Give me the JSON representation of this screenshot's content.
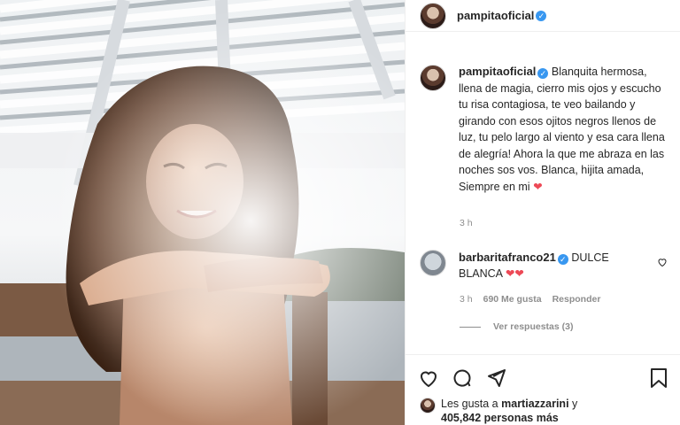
{
  "post": {
    "username": "pampitaoficial",
    "caption": "Blanquita hermosa, llena de magia, cierro mis ojos y escucho tu risa contagiosa, te veo bailando y girando con esos ojitos negros llenos de luz, tu pelo largo al viento y esa cara llena de alegría! Ahora la que me abraza en las noches sos vos. Blanca, hijita amada, Siempre en mi",
    "caption_emoji": "❤",
    "time": "3 h"
  },
  "comment": {
    "username": "barbaritafranco21",
    "text": "DULCE BLANCA",
    "emoji": "❤❤",
    "time": "3 h",
    "likes": "690 Me gusta",
    "reply": "Responder",
    "view_replies": "Ver respuestas (3)"
  },
  "likes": {
    "prefix": "Les gusta a",
    "user": "martiazzarini",
    "joiner": "y",
    "count": "405,842 personas más"
  },
  "icons": {
    "verified": "verified-badge",
    "like": "heart-icon",
    "comment": "comment-icon",
    "share": "paper-plane-icon",
    "save": "bookmark-icon"
  },
  "colors": {
    "verified": "#3897f0",
    "heart": "#ed4956",
    "muted": "#8e8e8e"
  }
}
